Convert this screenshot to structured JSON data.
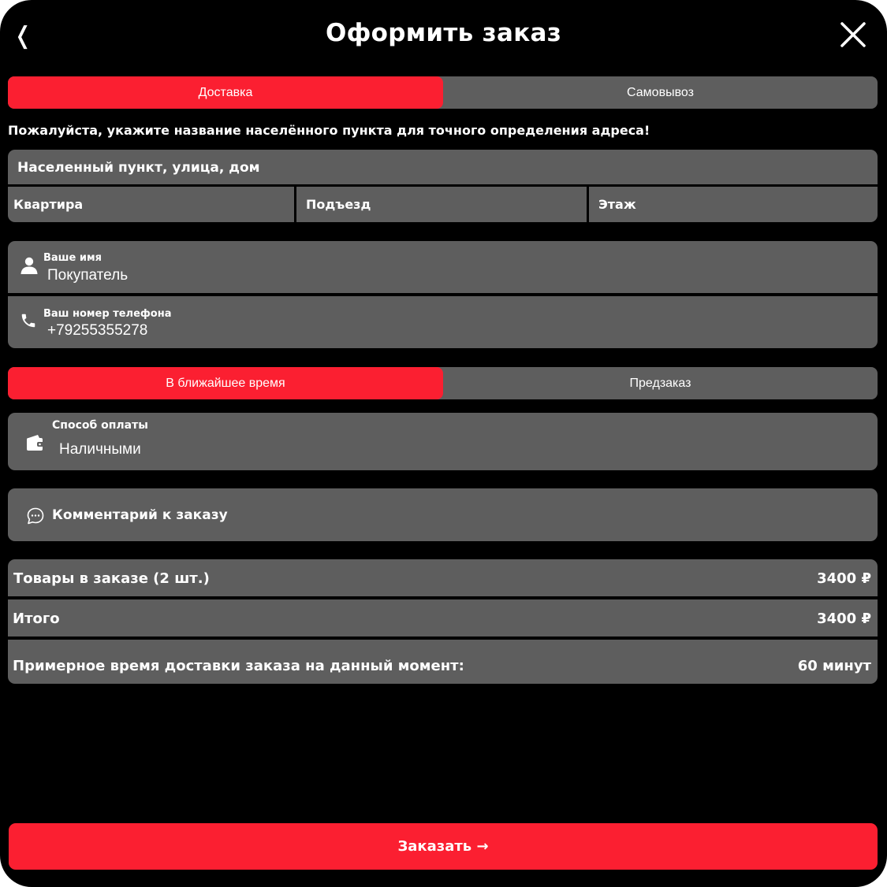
{
  "header": {
    "back_glyph": "❬",
    "title": "Оформить заказ"
  },
  "delivery_tabs": {
    "options": [
      {
        "label": "Доставка",
        "active": true
      },
      {
        "label": "Самовывоз",
        "active": false
      }
    ]
  },
  "address_hint": "Пожалуйста, укажите название населённого пункта для точного определения адреса!",
  "address": {
    "street_placeholder": "Населенный пункт, улица, дом",
    "apartment_placeholder": "Квартира",
    "entrance_placeholder": "Подъезд",
    "floor_placeholder": "Этаж"
  },
  "contact": {
    "name_label": "Ваше имя",
    "name_value": "Покупатель",
    "phone_label": "Ваш номер телефона",
    "phone_value": "+79255355278"
  },
  "time_tabs": {
    "options": [
      {
        "label": "В ближайшее время",
        "active": true
      },
      {
        "label": "Предзаказ",
        "active": false
      }
    ]
  },
  "payment": {
    "label": "Способ оплаты",
    "value": "Наличными"
  },
  "comment": {
    "placeholder": "Комментарий к заказу"
  },
  "summary": {
    "items_label": "Товары в заказе (2 шт.)",
    "items_value": "3400 ₽",
    "total_label": "Итого",
    "total_value": "3400 ₽",
    "eta_label": "Примерное время доставки заказа на данный момент:",
    "eta_value": "60 минут"
  },
  "submit_label": "Заказать →",
  "colors": {
    "accent": "#fb1f31",
    "field_bg": "#5e5e5e",
    "background": "#000000"
  },
  "icons": {
    "back": "chevron-left-icon",
    "close": "close-icon",
    "name": "user-icon",
    "phone": "phone-icon",
    "payment": "wallet-icon",
    "comment": "chat-bubble-icon"
  }
}
